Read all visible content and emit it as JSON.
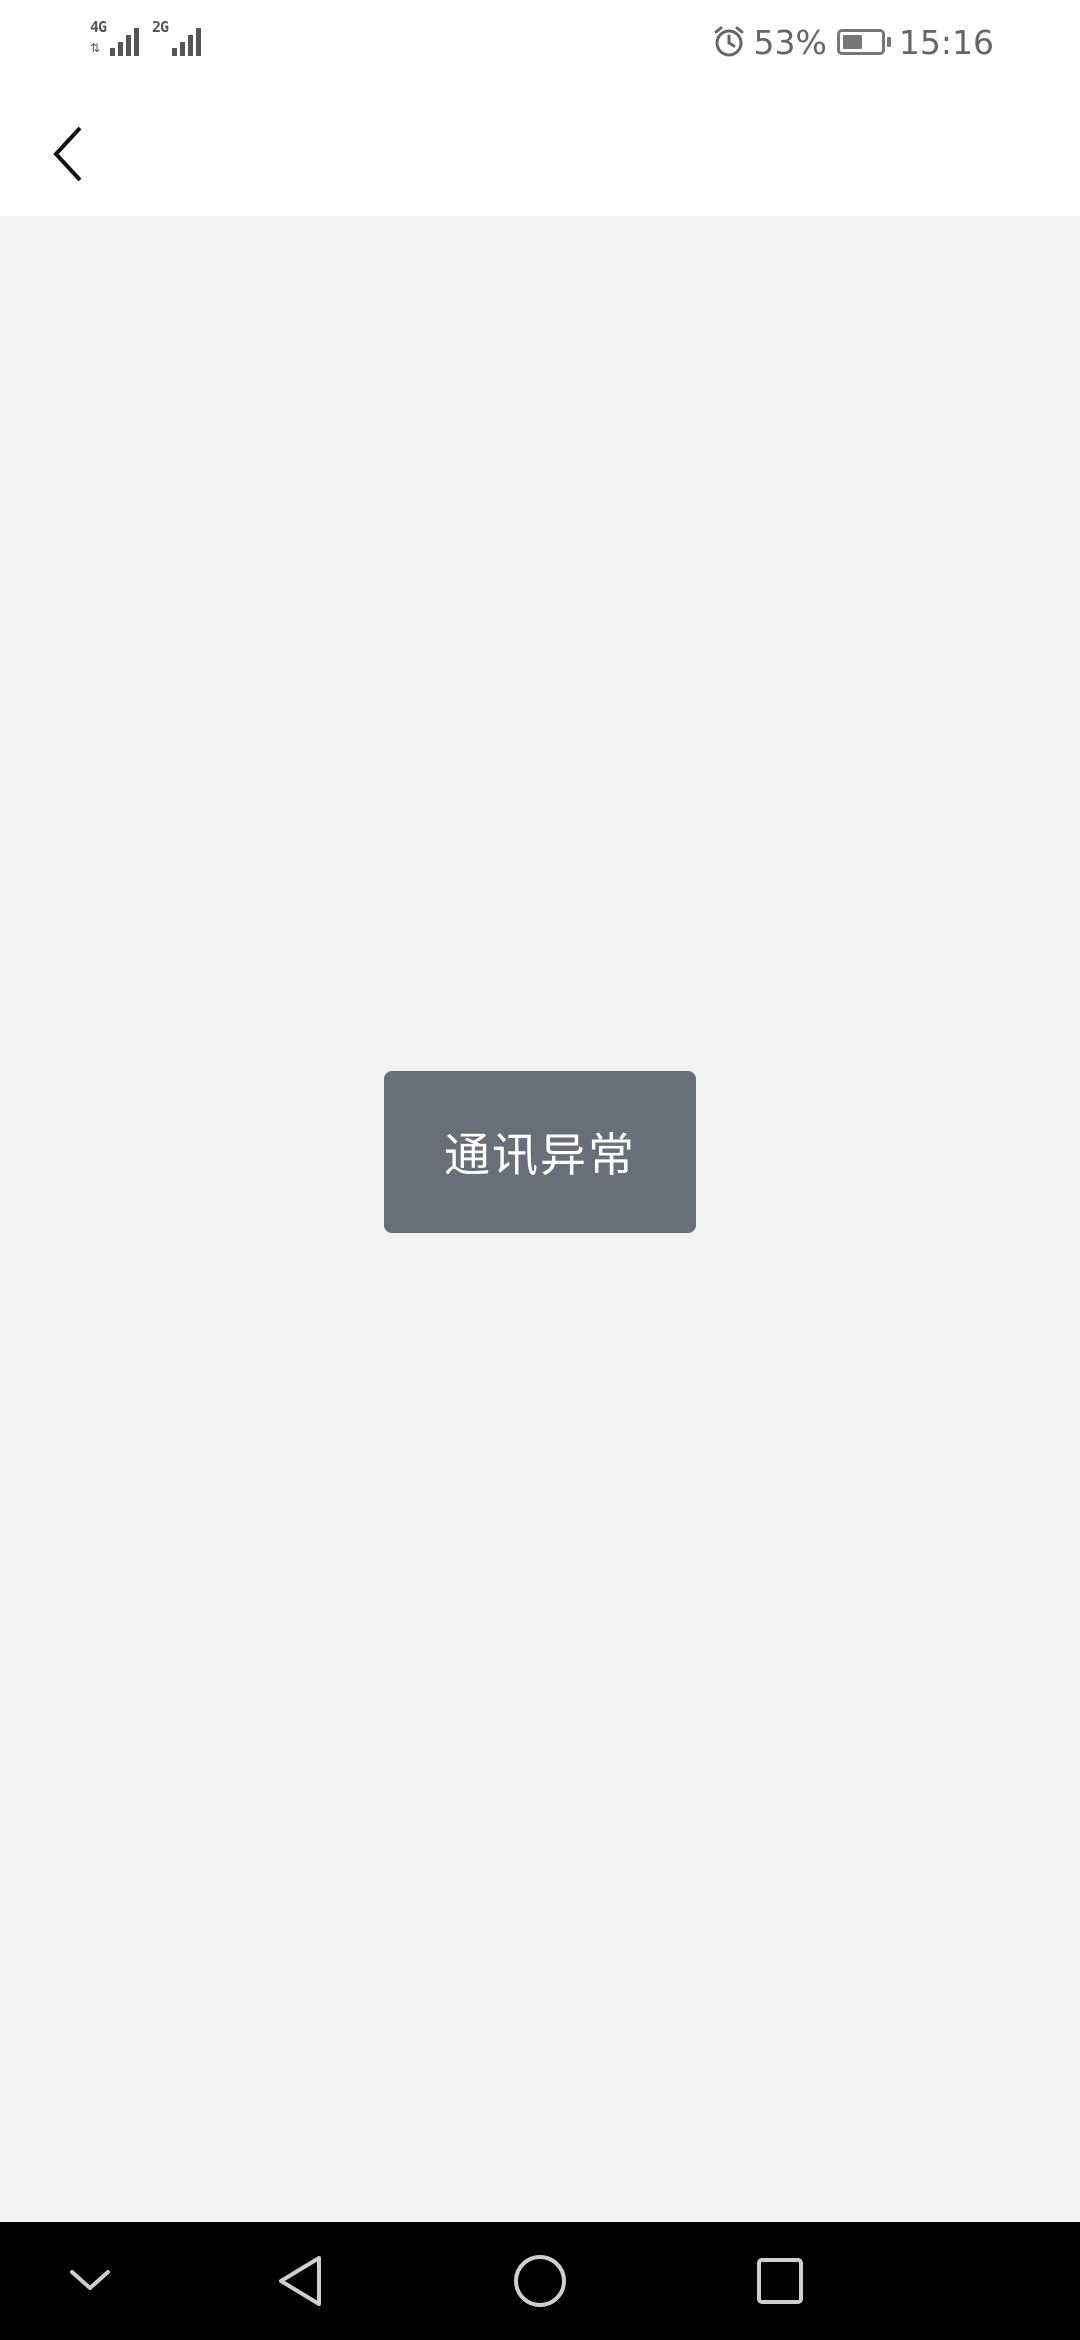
{
  "status_bar": {
    "signal_1_label": "4G",
    "signal_2_label": "2G",
    "signal_1_icon": "signal-icon",
    "signal_2_icon": "signal-icon",
    "alarm_icon": "alarm-icon",
    "battery_percent_text": "53%",
    "battery_level": 0.53,
    "time": "15:16"
  },
  "nav_bar": {
    "back_icon": "chevron-left-icon"
  },
  "toast": {
    "message": "通讯异常"
  },
  "system_nav": {
    "collapse_icon": "chevron-down-icon",
    "back_icon": "triangle-back-icon",
    "home_icon": "circle-home-icon",
    "recents_icon": "square-recents-icon"
  },
  "colors": {
    "background": "#f2f2f2",
    "toast_bg": "#6a6e78",
    "status_text": "#666666",
    "system_nav_bg": "#000000"
  }
}
